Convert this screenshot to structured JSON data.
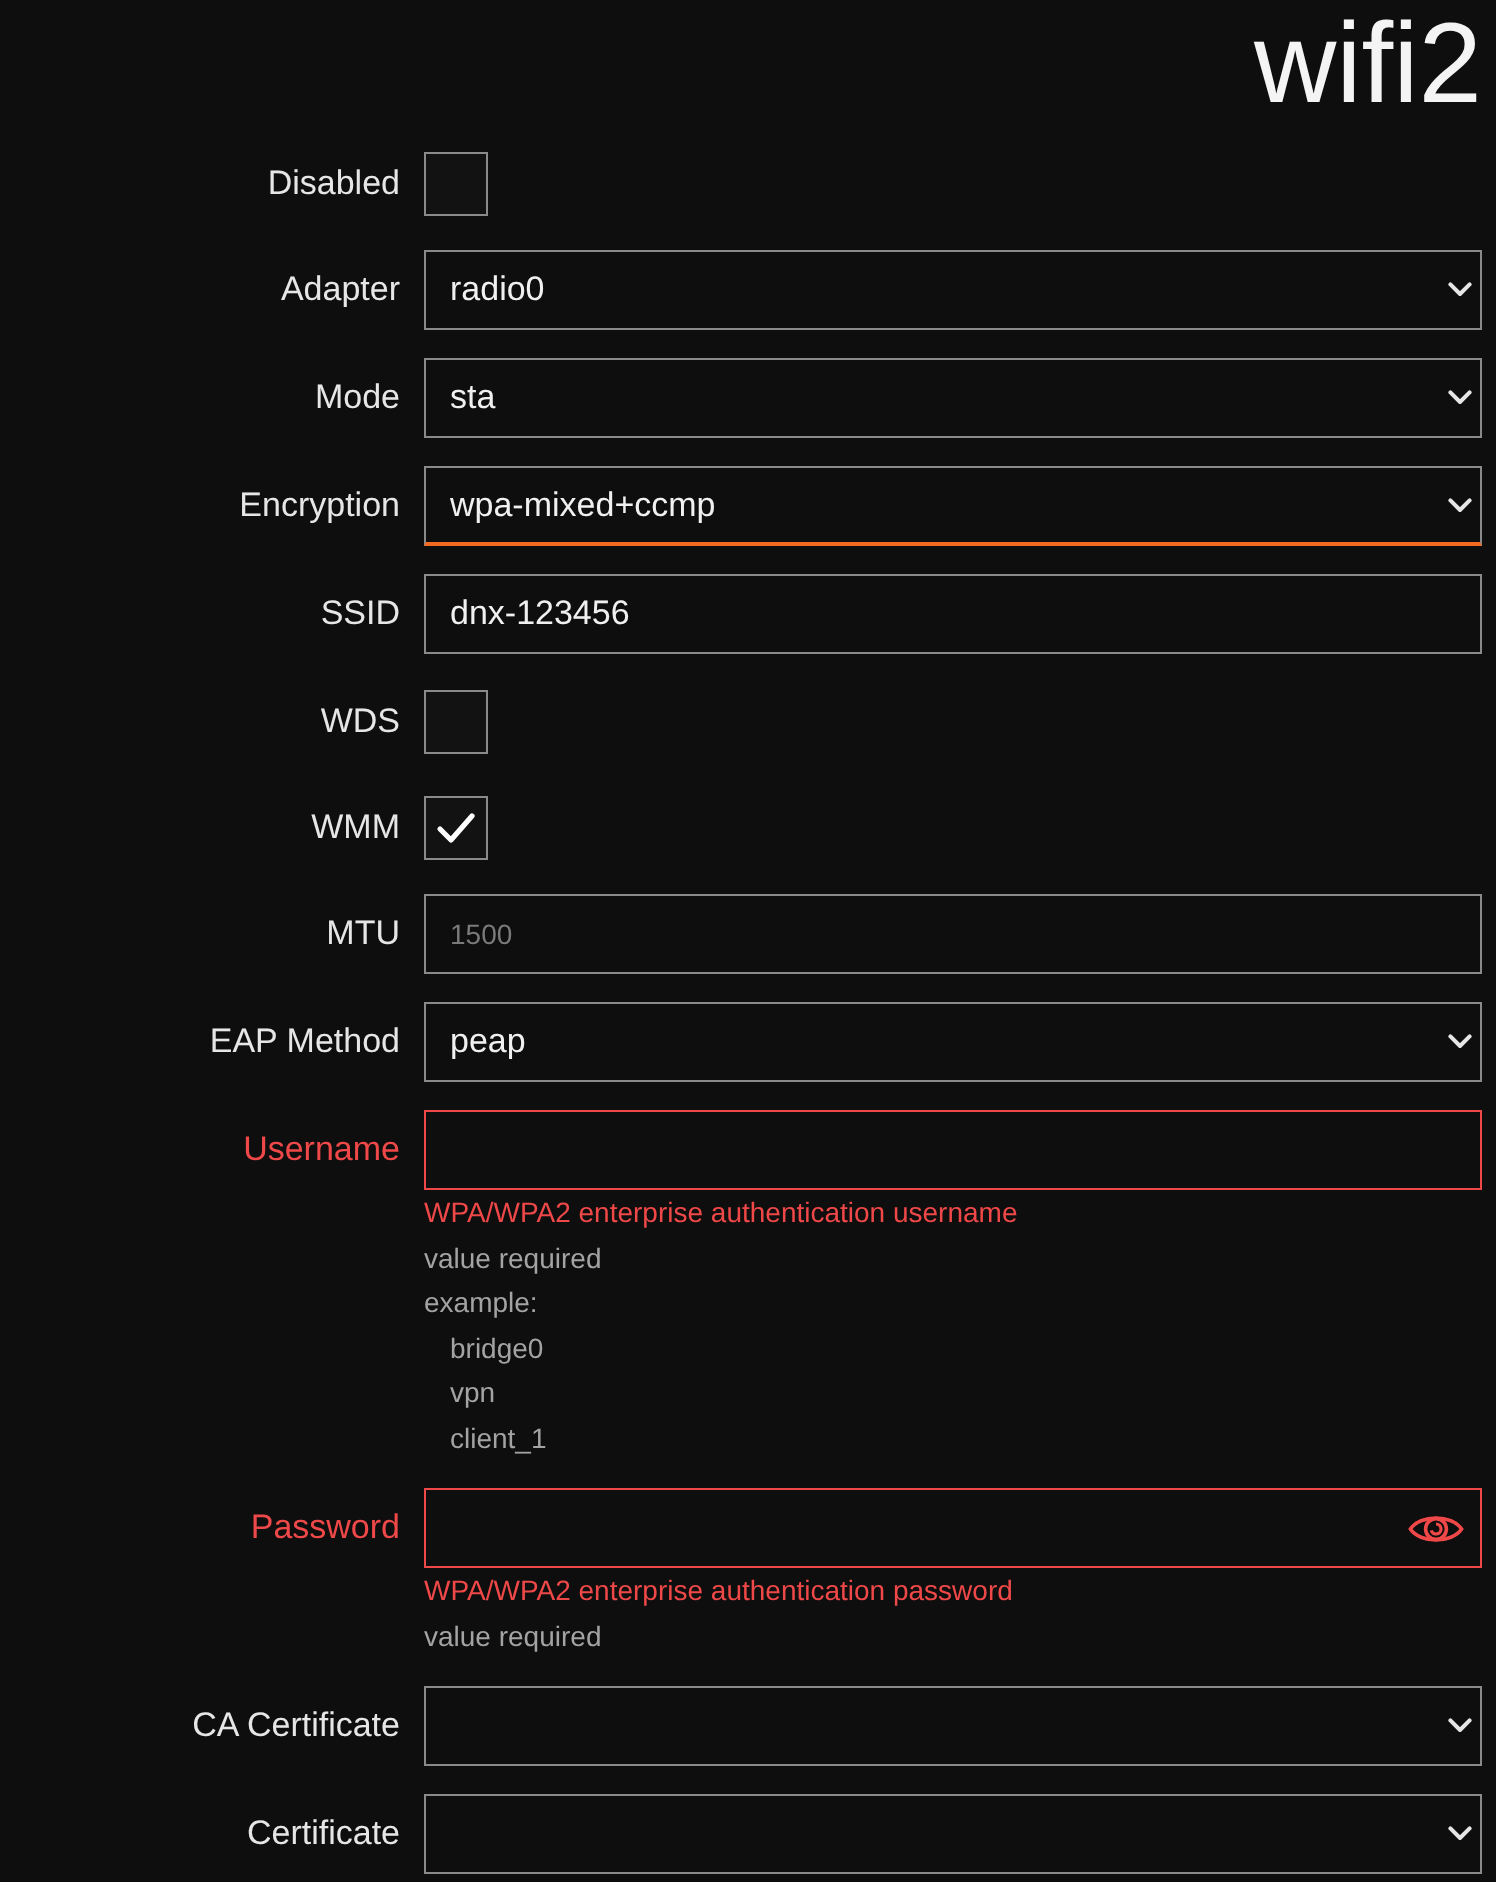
{
  "title": "wifi2",
  "fields": [
    {
      "kind": "checkbox",
      "label": "Disabled",
      "checked": false
    },
    {
      "kind": "select",
      "label": "Adapter",
      "value": "radio0",
      "focused": false,
      "invalid": false
    },
    {
      "kind": "select",
      "label": "Mode",
      "value": "sta",
      "focused": false,
      "invalid": false
    },
    {
      "kind": "select",
      "label": "Encryption",
      "value": "wpa-mixed+ccmp",
      "focused": true,
      "invalid": false
    },
    {
      "kind": "text",
      "label": "SSID",
      "value": "dnx-123456",
      "focused": false,
      "invalid": false
    },
    {
      "kind": "checkbox",
      "label": "WDS",
      "checked": false
    },
    {
      "kind": "checkbox",
      "label": "WMM",
      "checked": true
    },
    {
      "kind": "text",
      "label": "MTU",
      "placeholder": "1500",
      "focused": false,
      "invalid": false
    },
    {
      "kind": "select",
      "label": "EAP Method",
      "value": "peap",
      "focused": false,
      "invalid": false
    },
    {
      "kind": "text",
      "label": "Username",
      "focused": false,
      "invalid": true,
      "description": "WPA/WPA2 enterprise authentication username",
      "errors": [
        "value required"
      ],
      "example_heading": "example:",
      "examples": [
        "bridge0",
        "vpn",
        "client_1"
      ]
    },
    {
      "kind": "password",
      "label": "Password",
      "focused": false,
      "invalid": true,
      "description": "WPA/WPA2 enterprise authentication password",
      "errors": [
        "value required"
      ]
    },
    {
      "kind": "select",
      "label": "CA Certificate",
      "focused": false,
      "invalid": false
    },
    {
      "kind": "select",
      "label": "Certificate",
      "focused": false,
      "invalid": false
    }
  ]
}
